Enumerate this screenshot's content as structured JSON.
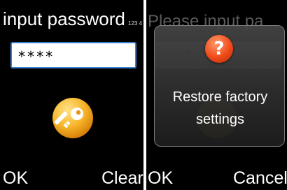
{
  "left_screen": {
    "title": "input password",
    "input_method": "123 4",
    "password_value": "****",
    "softkey_left": "OK",
    "softkey_right": "Clear"
  },
  "right_screen": {
    "background_title": "Please input pa",
    "background_password": "****",
    "dialog": {
      "icon_glyph": "?",
      "message_line1": "Restore factory",
      "message_line2": "settings"
    },
    "softkey_left": "OK",
    "softkey_right": "Cancel"
  },
  "colors": {
    "background": "#000000",
    "field_border": "#3a7fd0",
    "key_badge": "#f6b428",
    "question_badge": "#f04a1a"
  },
  "icons": {
    "key": "key-icon",
    "question": "question-mark-icon"
  }
}
